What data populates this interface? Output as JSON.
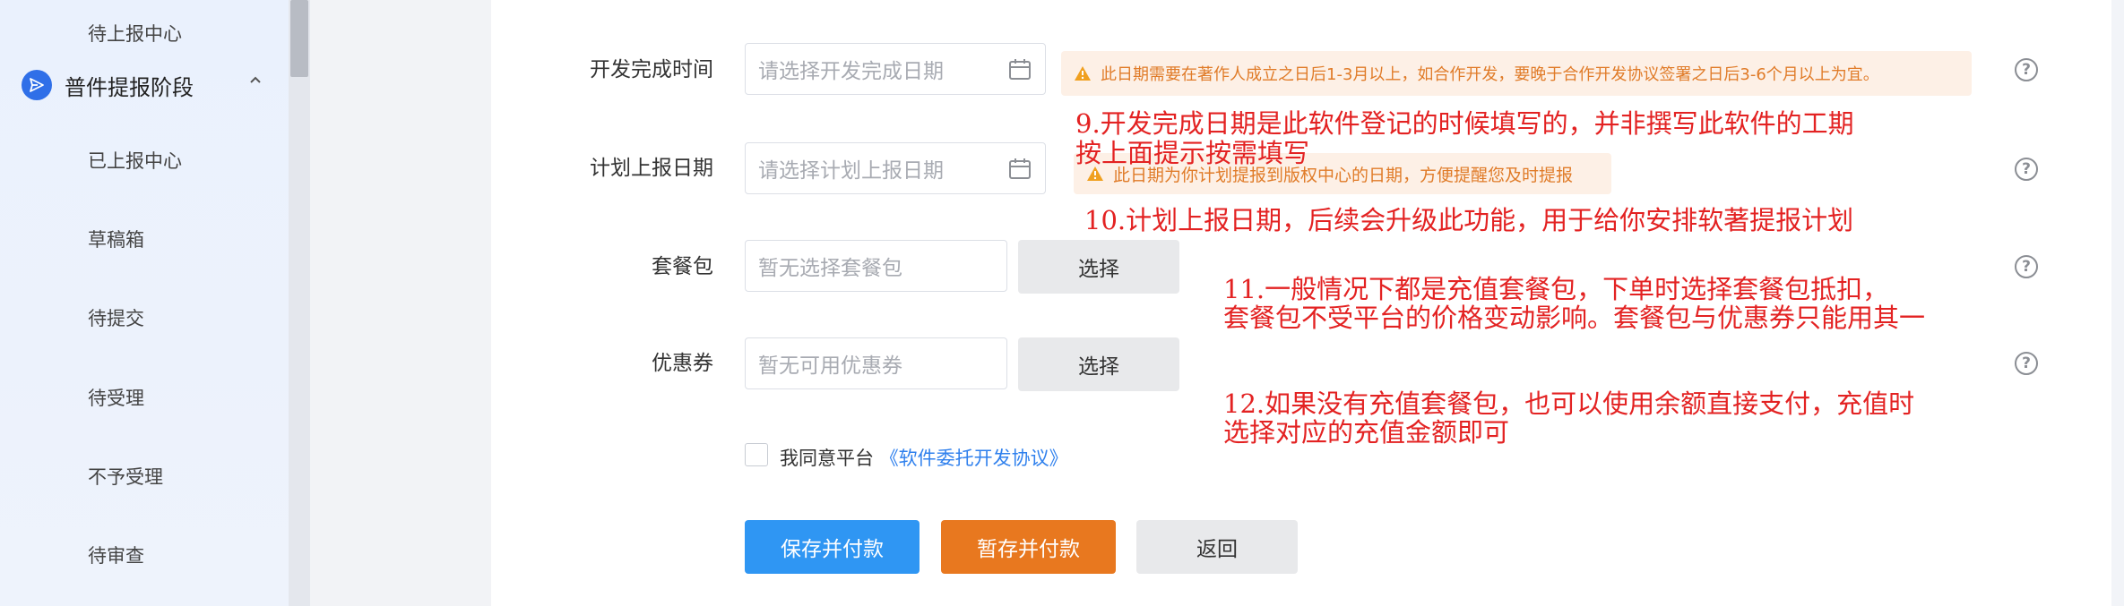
{
  "sidebar": {
    "top_item": "待上报中心",
    "group": {
      "label": "普件提报阶段",
      "icon": "send-icon",
      "expanded": true,
      "icon_color": "#2f6fe8"
    },
    "items": [
      {
        "label": "已上报中心"
      },
      {
        "label": "草稿箱"
      },
      {
        "label": "待提交"
      },
      {
        "label": "待受理"
      },
      {
        "label": "不予受理"
      },
      {
        "label": "待审查"
      }
    ]
  },
  "form": {
    "dev_date": {
      "label": "开发完成时间",
      "placeholder": "请选择开发完成日期",
      "warning": "此日期需要在著作人成立之日后1-3月以上，如合作开发，要晚于合作开发协议签署之日后3-6个月以上为宜。"
    },
    "report_date": {
      "label": "计划上报日期",
      "placeholder": "请选择计划上报日期",
      "warning": "此日期为你计划提报到版权中心的日期，方便提醒您及时提报"
    },
    "package": {
      "label": "套餐包",
      "placeholder": "暂无选择套餐包",
      "button": "选择"
    },
    "coupon": {
      "label": "优惠券",
      "placeholder": "暂无可用优惠券",
      "button": "选择"
    },
    "agreement": {
      "prefix": "我同意平台",
      "link": "《软件委托开发协议》"
    },
    "buttons": {
      "save_pay": "保存并付款",
      "temp_save_pay": "暂存并付款",
      "back": "返回"
    }
  },
  "annotations": {
    "a9_line1": "9.开发完成日期是此软件登记的时候填写的，并非撰写此软件的工期",
    "a9_line2": "按上面提示按需填写",
    "a10": "10.计划上报日期，后续会升级此功能，用于给你安排软著提报计划",
    "a11_line1": "11.一般情况下都是充值套餐包，下单时选择套餐包抵扣，",
    "a11_line2": "套餐包不受平台的价格变动影响。套餐包与优惠券只能用其一",
    "a12_line1": "12.如果没有充值套餐包，也可以使用余额直接支付，充值时",
    "a12_line2": "选择对应的充值金额即可"
  },
  "colors": {
    "primary": "#2f96f3",
    "orange": "#e8781f",
    "annotation": "#e32222",
    "warning_bg": "#fdf0e6",
    "warning_text": "#e07b28"
  }
}
